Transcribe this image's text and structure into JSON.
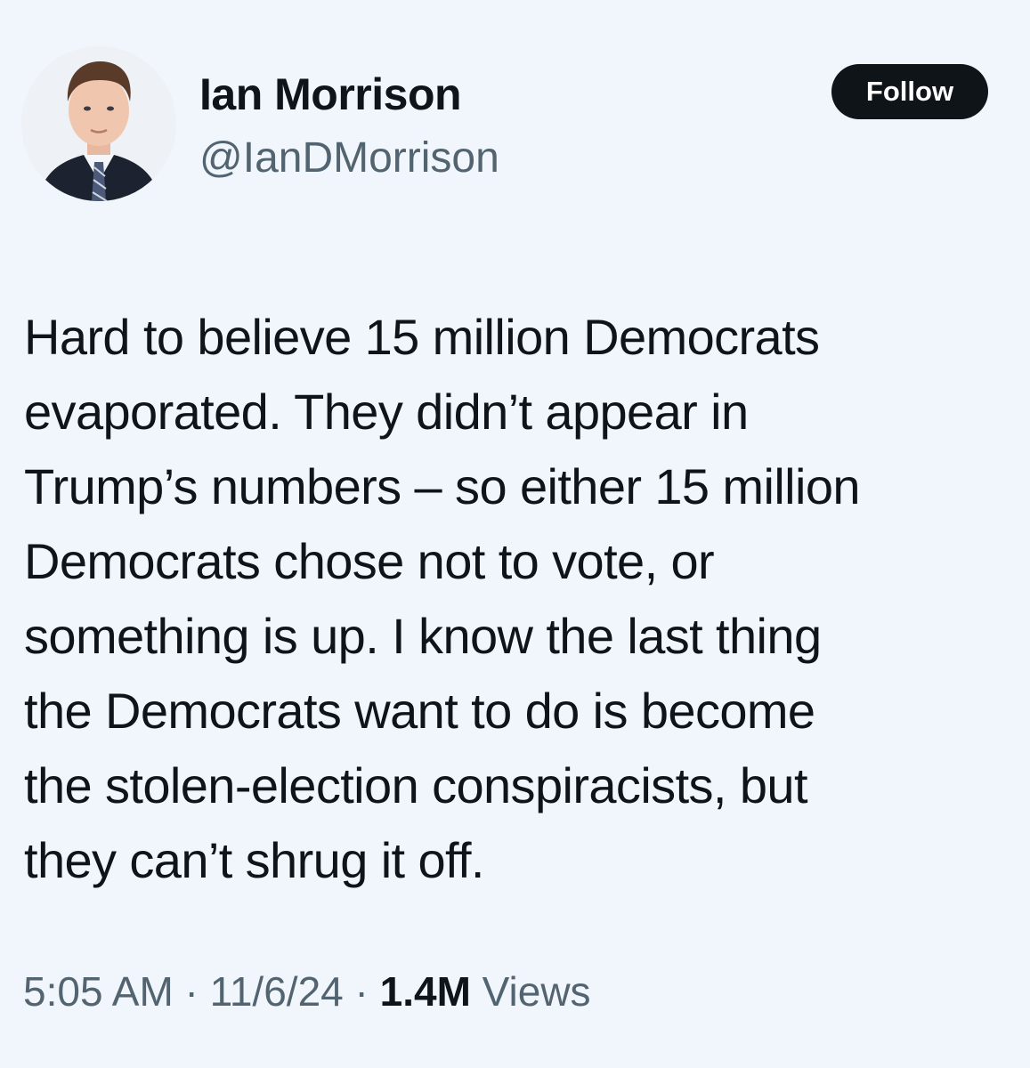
{
  "author": {
    "display_name": "Ian Morrison",
    "handle": "@IanDMorrison",
    "avatar_icon": "profile-photo"
  },
  "follow_label": "Follow",
  "tweet": {
    "lines": [
      "Hard to believe 15 million Democrats",
      "evaporated. They didn’t appear in",
      "Trump’s numbers – so either 15 million",
      "Democrats chose not to vote, or",
      "something is up. I know the last thing",
      "the Democrats want to do is become",
      "the stolen-election conspiracists, but",
      "they can’t shrug it off."
    ]
  },
  "meta": {
    "time": "5:05 AM",
    "separator": " · ",
    "date": "11/6/24",
    "views_count": "1.4M",
    "views_label": "Views"
  },
  "colors": {
    "background": "#f1f5fc",
    "text": "#0f1419",
    "secondary": "#536471",
    "button": "#0f1419"
  }
}
